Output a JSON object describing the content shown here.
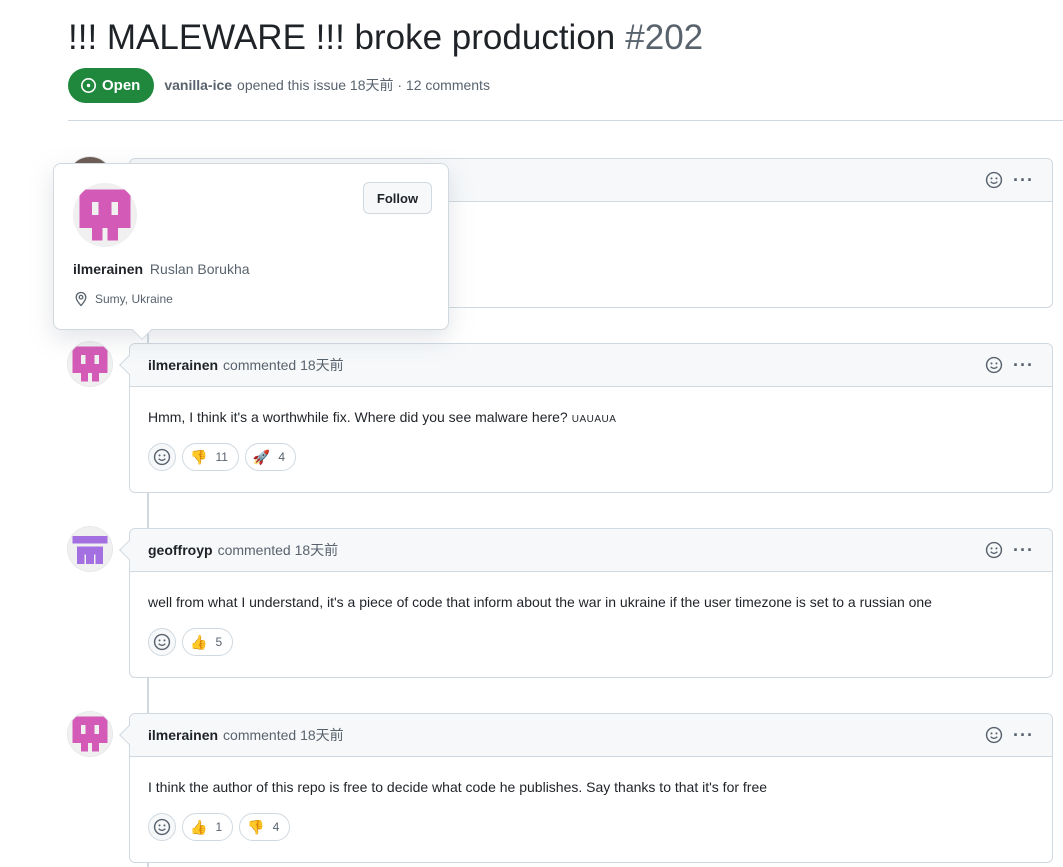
{
  "issue": {
    "title": "!!! MALEWARE !!! broke production",
    "number": "#202",
    "state_label": "Open",
    "author": "vanilla-ice",
    "opened_text": "opened this issue 18天前 · 12 comments"
  },
  "colors": {
    "open_green": "#1f883d",
    "avatar_pink": "#d35ab6",
    "avatar_purple": "#a46fe0"
  },
  "comments": [
    {
      "author": "ilmerainen",
      "action": "commented 18天前",
      "body": "Hmm, I think it's a worthwhile fix. Where did you see malware here?",
      "body_tail": "UAUAUA",
      "reactions": [
        {
          "icon": "thumbs-down-icon",
          "count": "11"
        },
        {
          "icon": "rocket-icon",
          "count": "4"
        }
      ]
    },
    {
      "author": "geoffroyp",
      "action": "commented 18天前",
      "body": "well from what I understand, it's a piece of code that inform about the war in ukraine if the user timezone is set to a russian one",
      "reactions": [
        {
          "icon": "thumbs-up-icon",
          "count": "5"
        }
      ]
    },
    {
      "author": "ilmerainen",
      "action": "commented 18天前",
      "body": "I think the author of this repo is free to decide what code he publishes. Say thanks to that it's for free",
      "reactions": [
        {
          "icon": "thumbs-up-icon",
          "count": "1"
        },
        {
          "icon": "thumbs-down-icon",
          "count": "4"
        }
      ]
    }
  ],
  "hovercard": {
    "login": "ilmerainen",
    "full_name": "Ruslan Borukha",
    "location": "Sumy, Ukraine",
    "follow_label": "Follow"
  }
}
